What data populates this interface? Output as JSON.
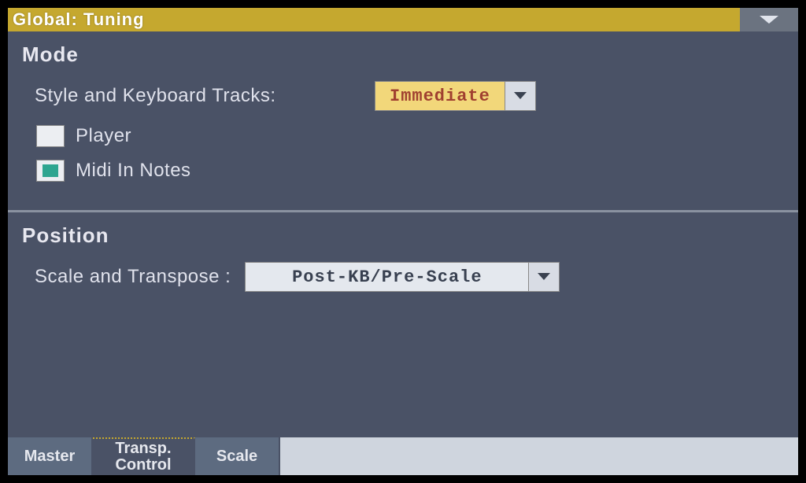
{
  "header": {
    "title": "Global: Tuning"
  },
  "mode": {
    "heading": "Mode",
    "style_tracks_label": "Style and Keyboard Tracks:",
    "style_tracks_value": "Immediate",
    "player_label": "Player",
    "player_checked": false,
    "midi_in_label": "Midi In Notes",
    "midi_in_checked": true
  },
  "position": {
    "heading": "Position",
    "scale_transpose_label": "Scale and Transpose :",
    "scale_transpose_value": "Post-KB/Pre-Scale"
  },
  "tabs": {
    "items": [
      {
        "label": "Master",
        "active": false
      },
      {
        "label": "Transp.\nControl",
        "active": true
      },
      {
        "label": "Scale",
        "active": false
      }
    ]
  }
}
